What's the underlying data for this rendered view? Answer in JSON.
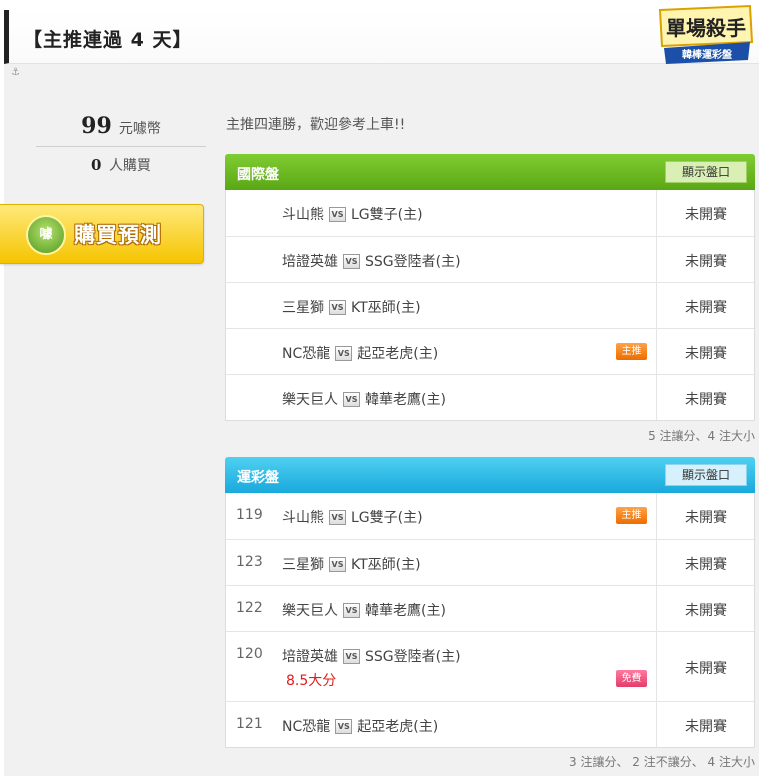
{
  "header": {
    "title": "【主推連過 4 天】",
    "logo_text": "單場殺手",
    "logo_sub": "韓棒運彩盤"
  },
  "anchor_icon": "anchor-icon",
  "left": {
    "price": "99",
    "price_unit": "元噱幣",
    "buyers": "0",
    "buyers_unit": "人購買",
    "buy_icon_text": "噱",
    "buy_label": "購買預測"
  },
  "intro": "主推四連勝，歡迎參考上車!!",
  "vs_label": "VS",
  "intl": {
    "title": "國際盤",
    "show_button": "顯示盤口",
    "rows": [
      {
        "away": "斗山熊",
        "home": "LG雙子(主)",
        "status": "未開賽",
        "badge": ""
      },
      {
        "away": "培證英雄",
        "home": "SSG登陸者(主)",
        "status": "未開賽",
        "badge": ""
      },
      {
        "away": "三星獅",
        "home": "KT巫師(主)",
        "status": "未開賽",
        "badge": ""
      },
      {
        "away": "NC恐龍",
        "home": "起亞老虎(主)",
        "status": "未開賽",
        "badge": "主推"
      },
      {
        "away": "樂天巨人",
        "home": "韓華老鷹(主)",
        "status": "未開賽",
        "badge": ""
      }
    ],
    "note": "5 注讓分、4 注大小"
  },
  "sports": {
    "title": "運彩盤",
    "show_button": "顯示盤口",
    "rows": [
      {
        "num": "119",
        "away": "斗山熊",
        "home": "LG雙子(主)",
        "status": "未開賽",
        "badge": "主推"
      },
      {
        "num": "123",
        "away": "三星獅",
        "home": "KT巫師(主)",
        "status": "未開賽",
        "badge": ""
      },
      {
        "num": "122",
        "away": "樂天巨人",
        "home": "韓華老鷹(主)",
        "status": "未開賽",
        "badge": ""
      },
      {
        "num": "120",
        "away": "培證英雄",
        "home": "SSG登陸者(主)",
        "status": "未開賽",
        "badge": "免費",
        "handicap": "8.5大分"
      },
      {
        "num": "121",
        "away": "NC恐龍",
        "home": "起亞老虎(主)",
        "status": "未開賽",
        "badge": ""
      }
    ],
    "note": "3 注讓分、 2 注不讓分、 4 注大小"
  },
  "colors": {
    "green_header": "#5aa715",
    "blue_header": "#19a9dc",
    "badge_orange": "#ec6d00",
    "badge_pink": "#e33c6a",
    "handicap_red": "#e31b1b",
    "buy_yellow": "#f5c400"
  }
}
